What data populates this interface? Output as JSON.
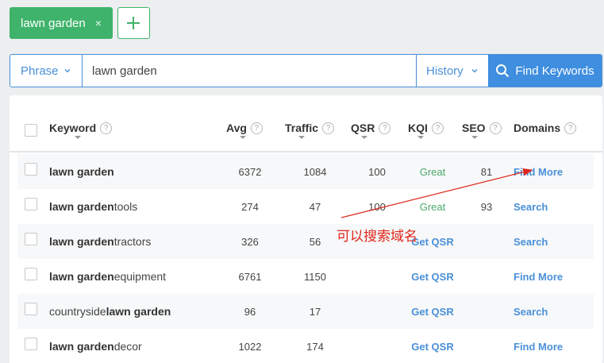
{
  "tags": [
    {
      "label": "lawn garden",
      "close": "×"
    }
  ],
  "search": {
    "mode": "Phrase",
    "query": "lawn garden",
    "history_label": "History",
    "button_label": "Find Keywords"
  },
  "table": {
    "headers": {
      "keyword": "Keyword",
      "avg": "Avg",
      "traffic": "Traffic",
      "qsr": "QSR",
      "kqi": "KQI",
      "seo": "SEO",
      "domains": "Domains"
    },
    "help": "?",
    "rows": [
      {
        "kw_prefix": "",
        "kw_bold": "lawn garden",
        "kw_suffix": "",
        "avg": "6372",
        "traffic": "1084",
        "qsr": "100",
        "kqi": "Great",
        "seo": "81",
        "domains": "Find More"
      },
      {
        "kw_prefix": "",
        "kw_bold": "lawn garden",
        "kw_suffix": " tools",
        "avg": "274",
        "traffic": "47",
        "qsr": "100",
        "kqi": "Great",
        "seo": "93",
        "domains": "Search"
      },
      {
        "kw_prefix": "",
        "kw_bold": "lawn garden",
        "kw_suffix": " tractors",
        "avg": "326",
        "traffic": "56",
        "qsr": "Get QSR",
        "kqi": "",
        "seo": "",
        "domains": "Search"
      },
      {
        "kw_prefix": "",
        "kw_bold": "lawn garden",
        "kw_suffix": " equipment",
        "avg": "6761",
        "traffic": "1150",
        "qsr": "Get QSR",
        "kqi": "",
        "seo": "",
        "domains": "Find More"
      },
      {
        "kw_prefix": "countryside ",
        "kw_bold": "lawn garden",
        "kw_suffix": "",
        "avg": "96",
        "traffic": "17",
        "qsr": "Get QSR",
        "kqi": "",
        "seo": "",
        "domains": "Search"
      },
      {
        "kw_prefix": "",
        "kw_bold": "lawn garden",
        "kw_suffix": " decor",
        "avg": "1022",
        "traffic": "174",
        "qsr": "Get QSR",
        "kqi": "",
        "seo": "",
        "domains": "Find More"
      }
    ]
  },
  "annotation": {
    "text": "可以搜索域名",
    "color": "#e0261a"
  },
  "colors": {
    "accent_green": "#3fb36b",
    "accent_blue": "#3f8ee0",
    "link_blue": "#4a90d9",
    "great_green": "#4ca96b"
  }
}
